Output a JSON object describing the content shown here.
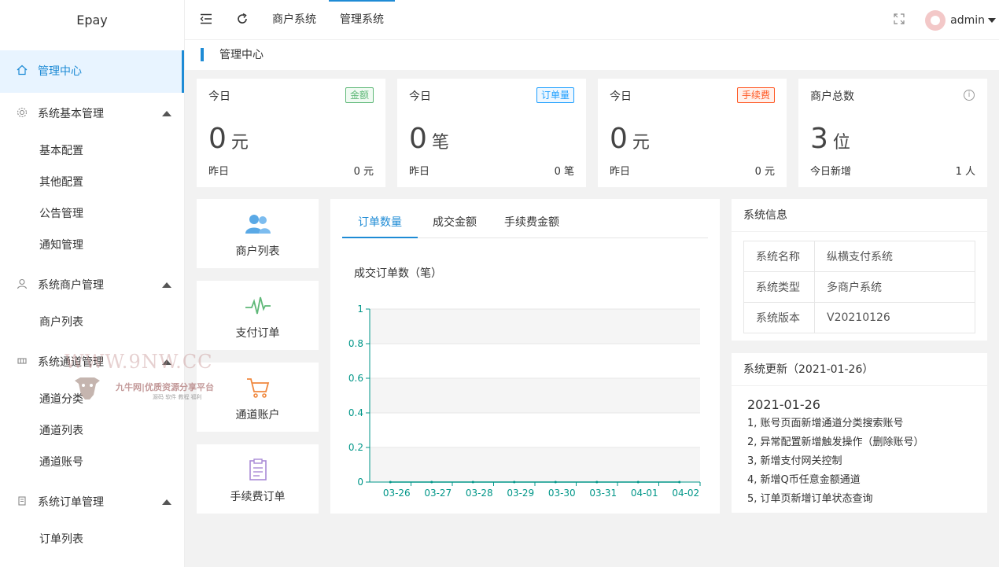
{
  "app": {
    "logo": "Epay"
  },
  "sidebar": {
    "home": "管理中心",
    "groups": [
      {
        "label": "系统基本管理",
        "icon": "gear-icon",
        "items": [
          "基本配置",
          "其他配置",
          "公告管理",
          "通知管理"
        ]
      },
      {
        "label": "系统商户管理",
        "icon": "user-icon",
        "items": [
          "商户列表"
        ]
      },
      {
        "label": "系统通道管理",
        "icon": "grid-icon",
        "items": [
          "通道分类",
          "通道列表",
          "通道账号"
        ]
      },
      {
        "label": "系统订单管理",
        "icon": "doc-icon",
        "items": [
          "订单列表"
        ]
      }
    ]
  },
  "topbar": {
    "tabs": [
      "商户系统",
      "管理系统"
    ],
    "active_tab": "管理系统",
    "user": "admin"
  },
  "breadcrumb": "管理中心",
  "stats": [
    {
      "head": "今日",
      "badge": "金额",
      "badge_color": "#5fb878",
      "value": "0",
      "unit": "元",
      "foot_label": "昨日",
      "foot_value": "0 元"
    },
    {
      "head": "今日",
      "badge": "订单量",
      "badge_color": "#1e9fff",
      "value": "0",
      "unit": "笔",
      "foot_label": "昨日",
      "foot_value": "0 笔"
    },
    {
      "head": "今日",
      "badge": "手续费",
      "badge_color": "#ff5722",
      "value": "0",
      "unit": "元",
      "foot_label": "昨日",
      "foot_value": "0 元"
    },
    {
      "head": "商户总数",
      "value": "3",
      "unit": "位",
      "foot_label": "今日新增",
      "foot_value": "1 人"
    }
  ],
  "shortcuts": [
    {
      "label": "商户列表",
      "icon": "users-icon"
    },
    {
      "label": "支付订单",
      "icon": "pulse-icon"
    },
    {
      "label": "通道账户",
      "icon": "cart-icon"
    },
    {
      "label": "手续费订单",
      "icon": "clipboard-icon"
    }
  ],
  "chart_tabs": [
    "订单数量",
    "成交金额",
    "手续费金额"
  ],
  "chart_data": {
    "type": "line",
    "title": "成交订单数（笔）",
    "categories": [
      "03-26",
      "03-27",
      "03-28",
      "03-29",
      "03-30",
      "03-31",
      "04-01",
      "04-02"
    ],
    "values": [
      0,
      0,
      0,
      0,
      0,
      0,
      0,
      0
    ],
    "yticks": [
      "0",
      "0.2",
      "0.4",
      "0.6",
      "0.8",
      "1"
    ],
    "ylim": [
      0,
      1
    ],
    "line_color": "#009688"
  },
  "system_info": {
    "title": "系统信息",
    "rows": [
      {
        "k": "系统名称",
        "v": "纵横支付系统"
      },
      {
        "k": "系统类型",
        "v": "多商户系统"
      },
      {
        "k": "系统版本",
        "v": "V20210126"
      }
    ]
  },
  "updates": {
    "title": "系统更新（2021-01-26）",
    "date": "2021-01-26",
    "items": [
      "1, 账号页面新增通道分类搜索账号",
      "2, 异常配置新增触发操作（删除账号）",
      "3, 新增支付网关控制",
      "4, 新增Q币任意金额通道",
      "5, 订单页新增订单状态查询"
    ]
  },
  "watermark": {
    "line1": "WWW.9NW.CC",
    "line2": "九牛网|优质资源分享平台",
    "line3": "源码 软件 教程 福利"
  }
}
